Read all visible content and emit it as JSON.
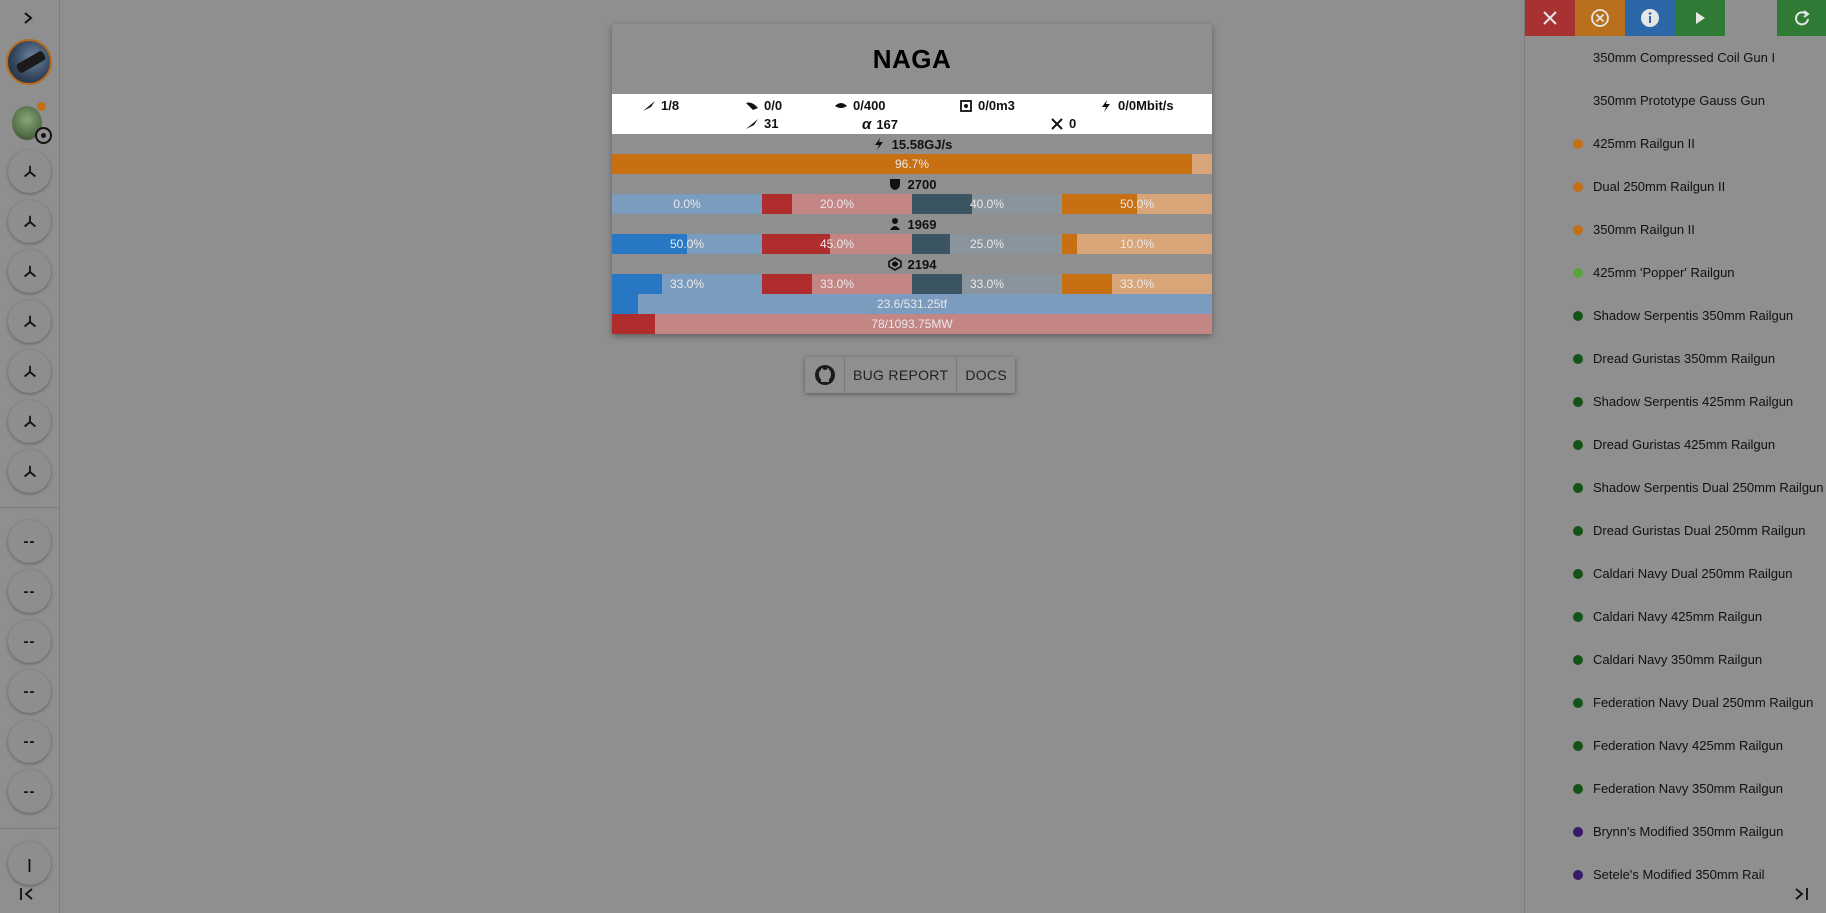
{
  "ship": {
    "name": "NAGA",
    "stats": {
      "launchers": "1/8",
      "drones": "0/0",
      "drone_bay": "0/400",
      "drone_volume": "0/0m3",
      "bandwidth": "0/0Mbit/s",
      "turrets": "31",
      "alpha": "167",
      "calibrate": "0"
    },
    "capacitor": {
      "label": "15.58GJ/s",
      "percent_label": "96.7%",
      "percent": 0.967
    },
    "shield": {
      "hp": "2700",
      "resists": [
        {
          "label": "0.0%",
          "value": 0.0
        },
        {
          "label": "20.0%",
          "value": 0.2
        },
        {
          "label": "40.0%",
          "value": 0.4
        },
        {
          "label": "50.0%",
          "value": 0.5
        }
      ]
    },
    "armor": {
      "hp": "1969",
      "resists": [
        {
          "label": "50.0%",
          "value": 0.5
        },
        {
          "label": "45.0%",
          "value": 0.45
        },
        {
          "label": "25.0%",
          "value": 0.25
        },
        {
          "label": "10.0%",
          "value": 0.1
        }
      ]
    },
    "hull": {
      "hp": "2194",
      "resists": [
        {
          "label": "33.0%",
          "value": 0.33
        },
        {
          "label": "33.0%",
          "value": 0.33
        },
        {
          "label": "33.0%",
          "value": 0.33
        },
        {
          "label": "33.0%",
          "value": 0.33
        }
      ]
    },
    "cpu": {
      "label": "23.6/531.25tf",
      "fraction": 0.044
    },
    "powergrid": {
      "label": "78/1093.75MW",
      "fraction": 0.071
    }
  },
  "links": {
    "bug_report": "BUG REPORT",
    "docs": "DOCS"
  },
  "left_rail": {
    "expand_icon": "chevron-right-icon",
    "slots": [
      "--",
      "--",
      "--",
      "--",
      "--",
      "--"
    ],
    "bottom_marker": "|"
  },
  "right_panel": {
    "toolbar": [
      "close-icon",
      "clear-circle-icon",
      "info-icon",
      "play-icon",
      "refresh-icon"
    ],
    "items": [
      {
        "label": "350mm Compressed Coil Gun I",
        "color": ""
      },
      {
        "label": "350mm Prototype Gauss Gun",
        "color": ""
      },
      {
        "label": "425mm Railgun II",
        "color": "#c26f16"
      },
      {
        "label": "Dual 250mm Railgun II",
        "color": "#c26f16"
      },
      {
        "label": "350mm Railgun II",
        "color": "#c26f16"
      },
      {
        "label": "425mm 'Popper' Railgun",
        "color": "#5aa33a"
      },
      {
        "label": "Shadow Serpentis 350mm Railgun",
        "color": "#155217"
      },
      {
        "label": "Dread Guristas 350mm Railgun",
        "color": "#155217"
      },
      {
        "label": "Shadow Serpentis 425mm Railgun",
        "color": "#155217"
      },
      {
        "label": "Dread Guristas 425mm Railgun",
        "color": "#155217"
      },
      {
        "label": "Shadow Serpentis Dual 250mm Railgun",
        "color": "#155217"
      },
      {
        "label": "Dread Guristas Dual 250mm Railgun",
        "color": "#155217"
      },
      {
        "label": "Caldari Navy Dual 250mm Railgun",
        "color": "#155217"
      },
      {
        "label": "Caldari Navy 425mm Railgun",
        "color": "#155217"
      },
      {
        "label": "Caldari Navy 350mm Railgun",
        "color": "#155217"
      },
      {
        "label": "Federation Navy Dual 250mm Railgun",
        "color": "#155217"
      },
      {
        "label": "Federation Navy 425mm Railgun",
        "color": "#155217"
      },
      {
        "label": "Federation Navy 350mm Railgun",
        "color": "#155217"
      },
      {
        "label": "Brynn's Modified 350mm Railgun",
        "color": "#3a1a66"
      },
      {
        "label": "Setele's Modified 350mm Rail",
        "color": "#3a1a66"
      }
    ]
  }
}
